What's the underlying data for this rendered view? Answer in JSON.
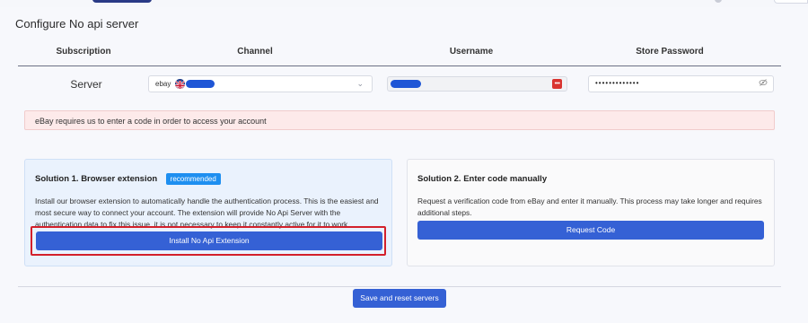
{
  "page": {
    "title": "Configure No api server"
  },
  "table": {
    "headers": {
      "subscription": "Subscription",
      "channel": "Channel",
      "username": "Username",
      "store_password": "Store Password"
    },
    "row": {
      "subscription": "Server",
      "channel_logo": "ebay",
      "channel_flag": "uk-flag-icon",
      "password_masked": "•••••••••••••"
    }
  },
  "alert": {
    "text": "eBay requires us to enter a code in order to access your account"
  },
  "solution1": {
    "title": "Solution 1. Browser extension",
    "badge": "recommended",
    "description": "Install our browser extension to automatically handle the authentication process. This is the easiest and most secure way to connect your account. The extension will provide No Api Server with the authentication data to fix this issue, it is not necessary to keep it constantly active for it to work.",
    "button_label": "Install No Api Extension"
  },
  "solution2": {
    "title": "Solution 2. Enter code manually",
    "description": "Request a verification code from eBay and enter it manually. This process may take longer and requires additional steps.",
    "button_label": "Request Code"
  },
  "footer": {
    "save_label": "Save and reset servers"
  },
  "colors": {
    "primary_button": "#3561d5",
    "badge": "#1e8ff0",
    "alert_bg": "#fdeaea",
    "highlight_border": "#d3202b",
    "redacted": "#1f56d6"
  }
}
